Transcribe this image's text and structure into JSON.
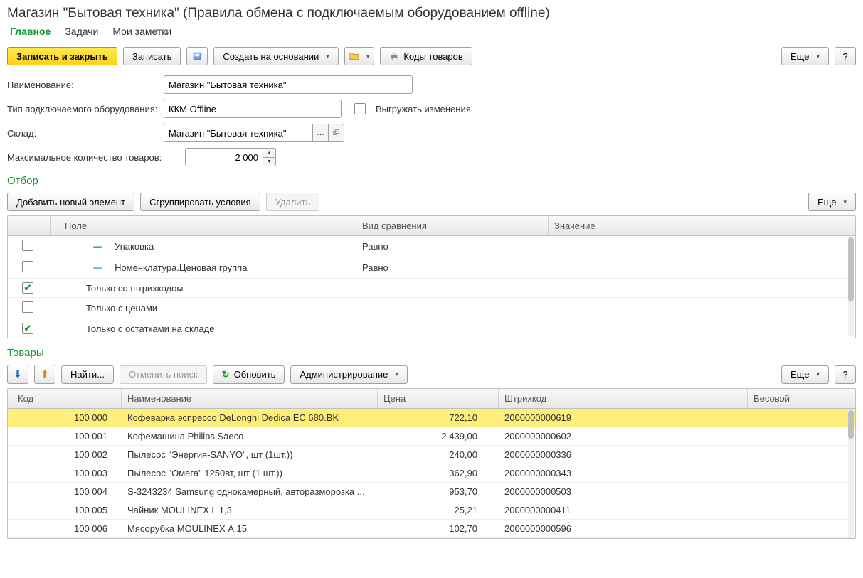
{
  "title": "Магазин \"Бытовая техника\" (Правила обмена с подключаемым оборудованием offline)",
  "tabs": [
    {
      "label": "Главное",
      "active": true
    },
    {
      "label": "Задачи",
      "active": false
    },
    {
      "label": "Мои заметки",
      "active": false
    }
  ],
  "toolbar": {
    "save_close": "Записать и закрыть",
    "save": "Записать",
    "create_based_on": "Создать на основании",
    "codes": "Коды товаров",
    "more": "Еще",
    "help": "?"
  },
  "form": {
    "name_label": "Наименование:",
    "name_value": "Магазин \"Бытовая техника\"",
    "type_label": "Тип подключаемого оборудования:",
    "type_value": "ККМ Offline",
    "upload_changes_label": "Выгружать изменения",
    "warehouse_label": "Склад:",
    "warehouse_value": "Магазин \"Бытовая техника\"",
    "max_qty_label": "Максимальное количество товаров:",
    "max_qty_value": "2 000"
  },
  "filter": {
    "title": "Отбор",
    "add": "Добавить новый элемент",
    "group": "Сгруппировать условия",
    "delete": "Удалить",
    "more": "Еще",
    "headers": {
      "field": "Поле",
      "comparison": "Вид сравнения",
      "value": "Значение"
    },
    "rows": [
      {
        "checked": false,
        "dash": true,
        "field": "Упаковка",
        "comparison": "Равно",
        "value": ""
      },
      {
        "checked": false,
        "dash": true,
        "field": "Номенклатура.Ценовая группа",
        "comparison": "Равно",
        "value": ""
      },
      {
        "checked": true,
        "dash": false,
        "field": "Только со штрихкодом",
        "comparison": "",
        "value": ""
      },
      {
        "checked": false,
        "dash": false,
        "field": "Только с ценами",
        "comparison": "",
        "value": ""
      },
      {
        "checked": true,
        "dash": false,
        "field": "Только с остатками на складе",
        "comparison": "",
        "value": ""
      }
    ]
  },
  "products": {
    "title": "Товары",
    "find": "Найти...",
    "cancel_find": "Отменить поиск",
    "refresh": "Обновить",
    "admin": "Администрирование",
    "more": "Еще",
    "help": "?",
    "headers": {
      "code": "Код",
      "name": "Наименование",
      "price": "Цена",
      "barcode": "Штрихкод",
      "weight": "Весовой"
    },
    "rows": [
      {
        "code": "100 000",
        "name": "Кофеварка эспрессо DeLonghi Dedica EC 680.BK",
        "price": "722,10",
        "barcode": "2000000000619",
        "selected": true
      },
      {
        "code": "100 001",
        "name": "Кофемашина Philips Saeco",
        "price": "2 439,00",
        "barcode": "2000000000602",
        "selected": false
      },
      {
        "code": "100 002",
        "name": "Пылесос \"Энергия-SANYO\", шт (1шт.))",
        "price": "240,00",
        "barcode": "2000000000336",
        "selected": false
      },
      {
        "code": "100 003",
        "name": "Пылесос \"Омега\" 1250вт, шт (1 шт.))",
        "price": "362,90",
        "barcode": "2000000000343",
        "selected": false
      },
      {
        "code": "100 004",
        "name": "S-3243234 Samsung однокамерный, авторазморозка ...",
        "price": "953,70",
        "barcode": "2000000000503",
        "selected": false
      },
      {
        "code": "100 005",
        "name": "Чайник MOULINEX L 1,3",
        "price": "25,21",
        "barcode": "2000000000411",
        "selected": false
      },
      {
        "code": "100 006",
        "name": "Мясорубка MOULINEX  А 15",
        "price": "102,70",
        "barcode": "2000000000596",
        "selected": false
      }
    ]
  }
}
